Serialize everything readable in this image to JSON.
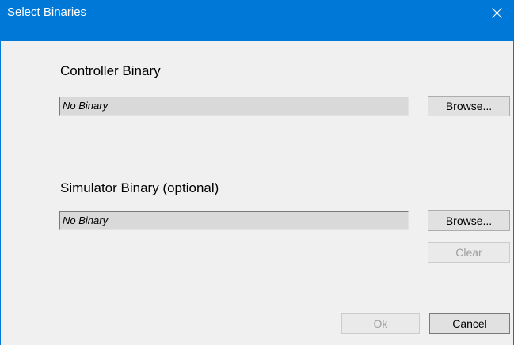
{
  "window": {
    "title": "Select Binaries"
  },
  "controller": {
    "heading": "Controller Binary",
    "field_value": "No Binary",
    "browse_label": "Browse..."
  },
  "simulator": {
    "heading": "Simulator Binary (optional)",
    "field_value": "No Binary",
    "browse_label": "Browse...",
    "clear_label": "Clear"
  },
  "footer": {
    "ok_label": "Ok",
    "cancel_label": "Cancel"
  },
  "colors": {
    "titlebar": "#0078d7",
    "dialog_background": "#f0f0f0",
    "field_background": "#d9d9d9"
  },
  "icons": {
    "close": "close-icon"
  }
}
